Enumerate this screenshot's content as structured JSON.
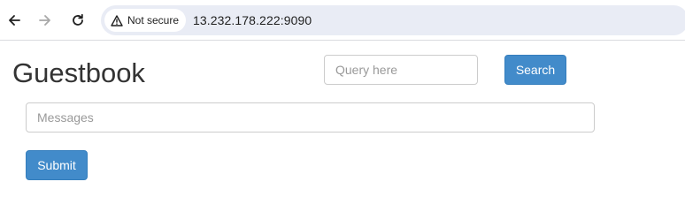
{
  "browser": {
    "back_icon": "arrow-left-icon",
    "forward_icon": "arrow-right-icon",
    "reload_icon": "reload-icon",
    "security_icon": "warning-triangle-icon",
    "security_label": "Not secure",
    "url": "13.232.178.222:9090"
  },
  "page": {
    "title": "Guestbook",
    "query_placeholder": "Query here",
    "query_value": "",
    "search_label": "Search",
    "messages_placeholder": "Messages",
    "messages_value": "",
    "submit_label": "Submit"
  },
  "colors": {
    "primary_button": "#428bca",
    "omnibox_bg": "#e9ecf5",
    "title_text": "#333333"
  }
}
